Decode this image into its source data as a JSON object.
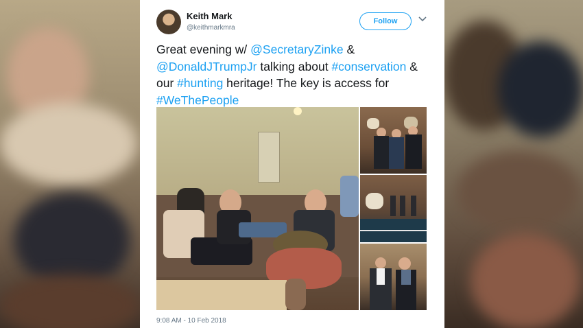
{
  "tweet": {
    "display_name": "Keith Mark",
    "handle": "@keithmarkmra",
    "follow_label": "Follow",
    "text_segments": [
      {
        "text": "Great evening w/ ",
        "link": false
      },
      {
        "text": "@SecretaryZinke",
        "link": true
      },
      {
        "text": " & ",
        "link": false
      },
      {
        "text": "@DonaldJTrumpJr",
        "link": true
      },
      {
        "text": " talking about ",
        "link": false
      },
      {
        "text": "#conservation",
        "link": true
      },
      {
        "text": " & our ",
        "link": false
      },
      {
        "text": "#hunting",
        "link": true
      },
      {
        "text": " heritage! The key is access for ",
        "link": false
      },
      {
        "text": "#WeThePeople",
        "link": true
      }
    ],
    "timestamp": "9:08 AM - 10 Feb 2018"
  },
  "icons": {
    "caret": "chevron-down-icon"
  },
  "colors": {
    "link": "#1da1f2",
    "text": "#14171a",
    "muted": "#657786",
    "card": "#ffffff"
  }
}
